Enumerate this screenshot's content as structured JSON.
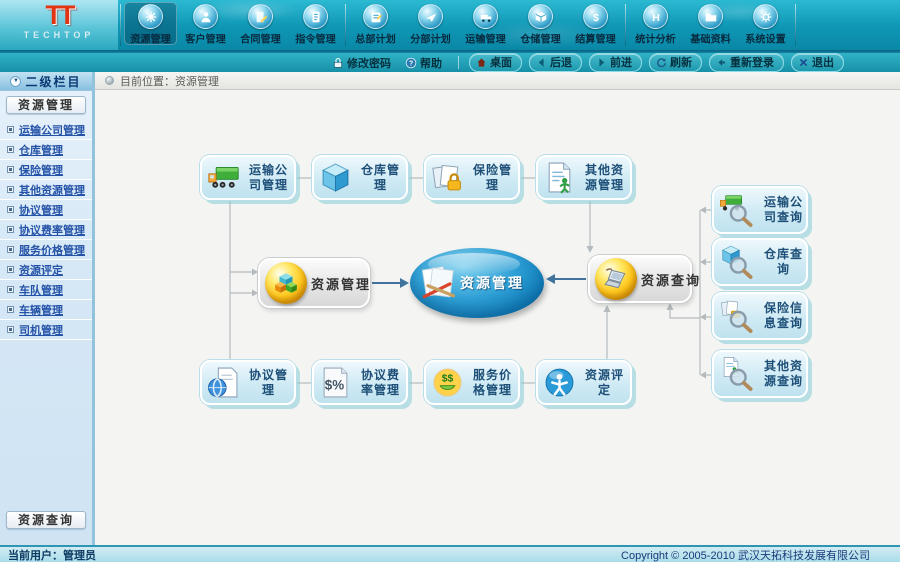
{
  "brand": {
    "logo_text": "TT",
    "name": "TECHTOP"
  },
  "top_nav": {
    "items": [
      {
        "label": "资源管理",
        "icon": "resource-manage-icon",
        "active": true
      },
      {
        "label": "客户管理",
        "icon": "customer-manage-icon",
        "active": false
      },
      {
        "label": "合同管理",
        "icon": "contract-manage-icon",
        "active": false
      },
      {
        "label": "指令管理",
        "icon": "order-manage-icon",
        "active": false
      },
      {
        "label": "总部计划",
        "icon": "hq-plan-icon",
        "active": false
      },
      {
        "label": "分部计划",
        "icon": "branch-plan-icon",
        "active": false
      },
      {
        "label": "运输管理",
        "icon": "transport-manage-icon",
        "active": false
      },
      {
        "label": "仓储管理",
        "icon": "storage-manage-icon",
        "active": false
      },
      {
        "label": "结算管理",
        "icon": "settlement-manage-icon",
        "active": false
      },
      {
        "label": "统计分析",
        "icon": "statistics-icon",
        "active": false
      },
      {
        "label": "基础资料",
        "icon": "base-data-icon",
        "active": false
      },
      {
        "label": "系统设置",
        "icon": "system-settings-icon",
        "active": false
      }
    ]
  },
  "toolbar": {
    "change_password": "修改密码",
    "help": "帮助",
    "desktop": "桌面",
    "back": "后退",
    "forward": "前进",
    "refresh": "刷新",
    "relogin": "重新登录",
    "exit": "退出"
  },
  "breadcrumb": {
    "label": "目前位置：资源管理"
  },
  "sidebar": {
    "header": "二级栏目",
    "section_button": "资源管理",
    "items": [
      "运输公司管理",
      "仓库管理",
      "保险管理",
      "其他资源管理",
      "协议管理",
      "协议费率管理",
      "服务价格管理",
      "资源评定",
      "车队管理",
      "车辆管理",
      "司机管理"
    ],
    "bottom_button": "资源查询"
  },
  "diagram": {
    "top_nodes": [
      {
        "label": "运输公司管理",
        "icon": "truck-icon"
      },
      {
        "label": "仓库管理",
        "icon": "warehouse-cube-icon"
      },
      {
        "label": "保险管理",
        "icon": "insurance-lock-icon"
      },
      {
        "label": "其他资源管理",
        "icon": "other-resource-doc-icon"
      }
    ],
    "hub_left": {
      "label": "资源管理",
      "icon": "resource-cubes-sphere-icon"
    },
    "hub_center": {
      "label": "资源管理",
      "icon": "paper-pencil-icon"
    },
    "hub_right": {
      "label": "资源查询",
      "icon": "laptop-sphere-icon"
    },
    "bottom_nodes": [
      {
        "label": "协议管理",
        "icon": "agreement-globe-icon"
      },
      {
        "label": "协议费率管理",
        "icon": "rate-doc-icon"
      },
      {
        "label": "服务价格管理",
        "icon": "price-face-icon"
      },
      {
        "label": "资源评定",
        "icon": "evaluate-person-icon"
      }
    ],
    "query_nodes": [
      {
        "label": "运输公司查询",
        "icon": "truck-magnifier-icon"
      },
      {
        "label": "仓库查询",
        "icon": "warehouse-magnifier-icon"
      },
      {
        "label": "保险信息查询",
        "icon": "insurance-magnifier-icon"
      },
      {
        "label": "其他资源查询",
        "icon": "other-resource-magnifier-icon"
      }
    ]
  },
  "statusbar": {
    "current_user": "当前用户：管理员",
    "copyright": "Copyright © 2005-2010 武汉天拓科技发展有限公司"
  },
  "colors": {
    "banner_teal": "#0e96b4",
    "toolbar_teal": "#1690a8",
    "active_tab_bg": "#04425e",
    "breadcrumb_bg": "#ececea",
    "sidebar_bg": "#d6e8f6",
    "link_blue": "#2553a8",
    "node_fill": "#cfeaf4",
    "node_shadow": "#79cad4",
    "node_text": "#1d4f78",
    "hub_ellipse_blue": "#1180bc",
    "sphere_yellow": "#ffc81e",
    "status_bg": "#a9dde9",
    "arrow_blue": "#41749c",
    "line_gray": "#b4babd"
  }
}
